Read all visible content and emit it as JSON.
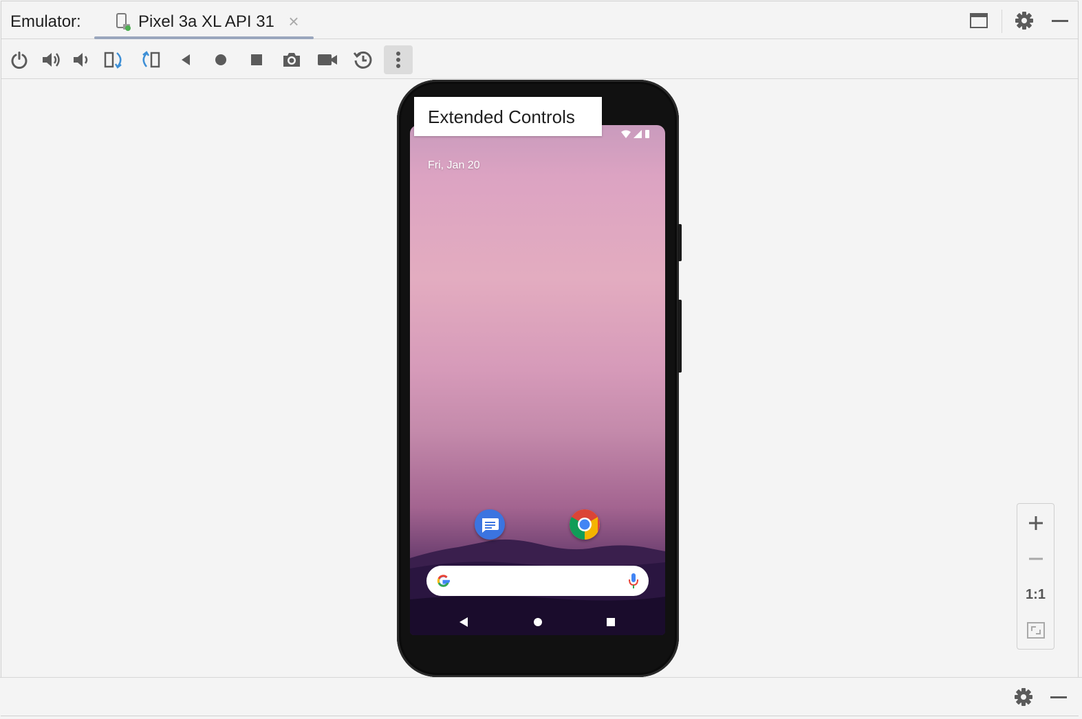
{
  "window": {
    "label": "Emulator:",
    "tab_label": "Pixel 3a XL API 31",
    "tab_close": "×"
  },
  "title_actions": [
    "window-mode-icon",
    "settings-gear-icon",
    "minimize-icon"
  ],
  "toolbar": {
    "buttons": [
      "power-icon",
      "volume-up-icon",
      "volume-down-icon",
      "rotate-left-icon",
      "rotate-right-icon",
      "back-icon",
      "home-icon",
      "overview-icon",
      "screenshot-icon",
      "screen-record-icon",
      "snapshot-icon",
      "more-options-icon"
    ]
  },
  "device": {
    "tooltip": "Extended Controls",
    "date": "Fri, Jan 20",
    "apps": [
      "messages-icon",
      "chrome-icon"
    ],
    "search_bar": [
      "google-logo",
      "mic-icon"
    ],
    "nav": [
      "nav-back-icon",
      "nav-home-icon",
      "nav-recents-icon"
    ]
  },
  "zoom": {
    "ratio_label": "1:1",
    "buttons": [
      "zoom-in-icon",
      "zoom-out-icon",
      "actual-size",
      "fit-screen-icon"
    ]
  },
  "colors": {
    "accent_blue": "#3d8fd6",
    "tab_underline": "#9aa6bd",
    "icon_gray": "#5b5b5b"
  }
}
